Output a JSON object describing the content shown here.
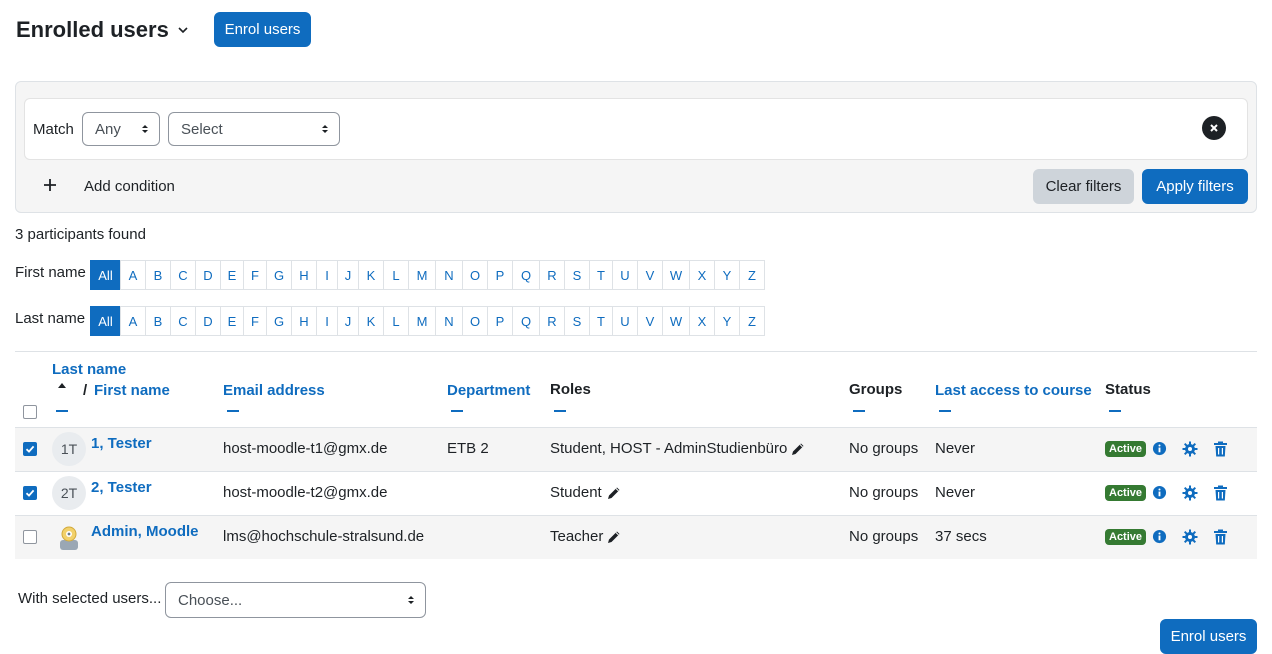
{
  "header": {
    "title": "Enrolled users",
    "enrol_button": "Enrol users"
  },
  "filters": {
    "match_label": "Match",
    "match_value": "Any",
    "condition_value": "Select",
    "add_condition": "Add condition",
    "clear_filters": "Clear filters",
    "apply_filters": "Apply filters"
  },
  "summary": {
    "participants_found": "3 participants found"
  },
  "initials": {
    "first_name_label": "First name",
    "last_name_label": "Last name",
    "all_label": "All",
    "letters": [
      "A",
      "B",
      "C",
      "D",
      "E",
      "F",
      "G",
      "H",
      "I",
      "J",
      "K",
      "L",
      "M",
      "N",
      "O",
      "P",
      "Q",
      "R",
      "S",
      "T",
      "U",
      "V",
      "W",
      "X",
      "Y",
      "Z"
    ]
  },
  "table": {
    "headers": {
      "last_name": "Last name",
      "sep": "/",
      "first_name": "First name",
      "email": "Email address",
      "department": "Department",
      "roles": "Roles",
      "groups": "Groups",
      "last_access": "Last access to course",
      "status": "Status"
    },
    "rows": [
      {
        "checked": true,
        "avatar": "1T",
        "name": "1, Tester",
        "email": "host-moodle-t1@gmx.de",
        "department": "ETB 2",
        "roles": "Student, HOST - AdminStudienbüro",
        "groups": "No groups",
        "last_access": "Never",
        "status": "Active"
      },
      {
        "checked": true,
        "avatar": "2T",
        "name": "2, Tester",
        "email": "host-moodle-t2@gmx.de",
        "department": "",
        "roles": "Student",
        "groups": "No groups",
        "last_access": "Never",
        "status": "Active"
      },
      {
        "checked": false,
        "avatar": "",
        "name": "Admin, Moodle",
        "email": "lms@hochschule-stralsund.de",
        "department": "",
        "roles": "Teacher",
        "groups": "No groups",
        "last_access": "37 secs",
        "status": "Active"
      }
    ]
  },
  "bulk": {
    "with_selected": "With selected users...",
    "choose": "Choose...",
    "enrol_button": "Enrol users"
  },
  "colors": {
    "primary": "#0f6cbf",
    "active_badge": "#357a32",
    "delete_icon": "#0f6cbf"
  }
}
